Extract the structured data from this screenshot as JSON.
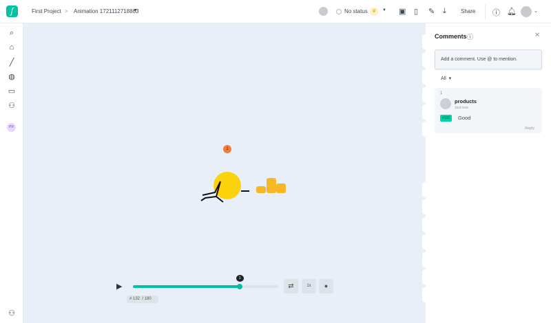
{
  "header": {
    "project": "First Project",
    "separator": ">",
    "animation": "Animation 1721112718863",
    "status": "No status",
    "share": "Share"
  },
  "sidebar": {
    "avatar_initials": "PR"
  },
  "player": {
    "frame": "# 132",
    "total": "/ 180",
    "speed": "1x",
    "marker": "1",
    "progress": 0.733
  },
  "canvas": {
    "comment_pin": "1",
    "zoom": "100%"
  },
  "comments": {
    "title": "Comments",
    "placeholder": "Add a comment. Use @ to mention.",
    "filter": "All",
    "items": [
      {
        "number": "1",
        "author": "products",
        "time": "Just now",
        "frame_badge": "#132",
        "text": "Good",
        "reply": "Reply"
      }
    ]
  },
  "colors": {
    "accent": "#00c1a2",
    "canvas": "#e8eff8",
    "pin": "#f07d3c"
  }
}
